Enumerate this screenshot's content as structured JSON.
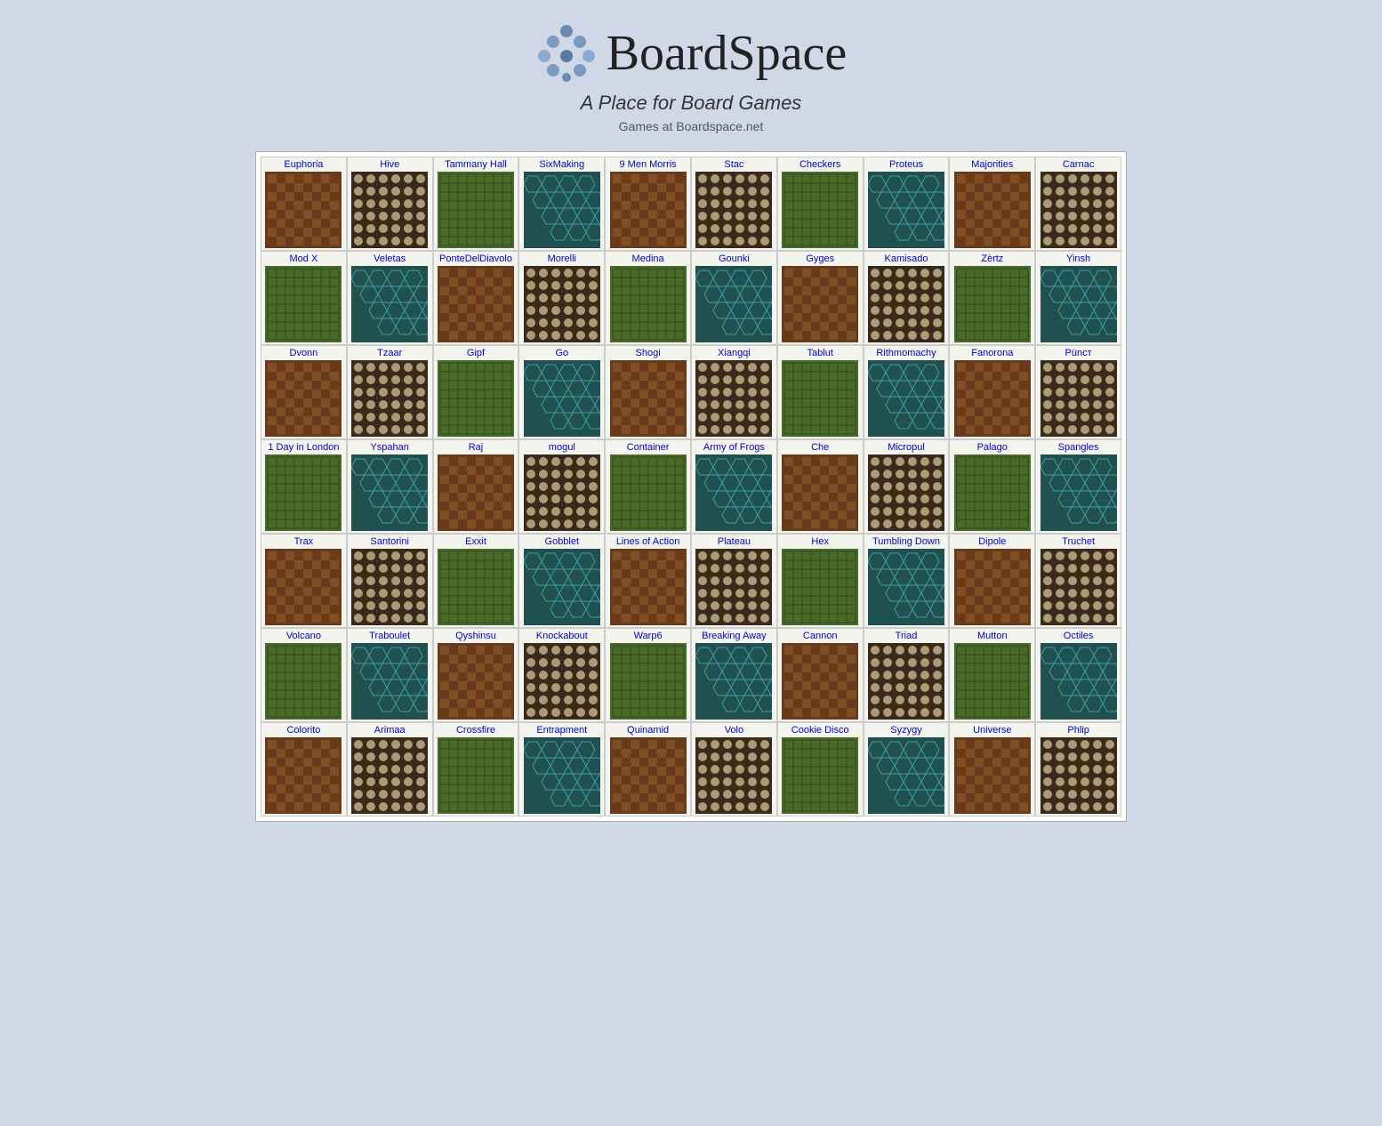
{
  "site": {
    "title": "BoardSpace",
    "tagline": "A Place for Board Games",
    "games_label": "Games at Boardspace.net"
  },
  "games": [
    {
      "name": "Euphoria",
      "color": "c-red"
    },
    {
      "name": "Hive",
      "color": "c-brown"
    },
    {
      "name": "Tammany Hall",
      "color": "c-orange"
    },
    {
      "name": "SixMaking",
      "color": "c-gray"
    },
    {
      "name": "9 Men Morris",
      "color": "c-tan"
    },
    {
      "name": "Stac",
      "color": "c-wood"
    },
    {
      "name": "Checkers",
      "color": "c-dark"
    },
    {
      "name": "Proteus",
      "color": "c-olive"
    },
    {
      "name": "Majorities",
      "color": "c-slate"
    },
    {
      "name": "Carnac",
      "color": "c-navy"
    },
    {
      "name": "Mod X",
      "color": "c-gray"
    },
    {
      "name": "Veletas",
      "color": "c-brown"
    },
    {
      "name": "PonteDelDiavolo",
      "color": "c-blue"
    },
    {
      "name": "Morelli",
      "color": "c-green"
    },
    {
      "name": "Medina",
      "color": "c-tan"
    },
    {
      "name": "Gounki",
      "color": "c-dark"
    },
    {
      "name": "Gyges",
      "color": "c-wood"
    },
    {
      "name": "Kamisado",
      "color": "c-purple"
    },
    {
      "name": "Zèrtz",
      "color": "c-dark"
    },
    {
      "name": "Yinsh",
      "color": "c-cream"
    },
    {
      "name": "Dvonn",
      "color": "c-slate"
    },
    {
      "name": "Tzaar",
      "color": "c-dark"
    },
    {
      "name": "Gipf",
      "color": "c-gray"
    },
    {
      "name": "Go",
      "color": "c-green"
    },
    {
      "name": "Shogi",
      "color": "c-tan"
    },
    {
      "name": "Xiangqi",
      "color": "c-wood"
    },
    {
      "name": "Tablut",
      "color": "c-cream"
    },
    {
      "name": "Rithmomachy",
      "color": "c-brown"
    },
    {
      "name": "Fanorona",
      "color": "c-wood"
    },
    {
      "name": "Püncт",
      "color": "c-gray"
    },
    {
      "name": "1 Day in London",
      "color": "c-blue"
    },
    {
      "name": "Yspahan",
      "color": "c-yellow"
    },
    {
      "name": "Raj",
      "color": "c-red"
    },
    {
      "name": "mogul",
      "color": "c-green"
    },
    {
      "name": "Container",
      "color": "c-teal"
    },
    {
      "name": "Army of Frogs",
      "color": "c-green"
    },
    {
      "name": "Che",
      "color": "c-blue"
    },
    {
      "name": "Micropul",
      "color": "c-orange"
    },
    {
      "name": "Palago",
      "color": "c-olive"
    },
    {
      "name": "Spangles",
      "color": "c-green"
    },
    {
      "name": "Trax",
      "color": "c-green"
    },
    {
      "name": "Santorini",
      "color": "c-gray"
    },
    {
      "name": "Exxit",
      "color": "c-red"
    },
    {
      "name": "Gobblet",
      "color": "c-wood"
    },
    {
      "name": "Lines of Action",
      "color": "c-dark"
    },
    {
      "name": "Plateau",
      "color": "c-tan"
    },
    {
      "name": "Hex",
      "color": "c-pink"
    },
    {
      "name": "Tumbling Down",
      "color": "c-brown"
    },
    {
      "name": "Dipole",
      "color": "c-wood"
    },
    {
      "name": "Truchet",
      "color": "c-blue"
    },
    {
      "name": "Volcano",
      "color": "c-olive"
    },
    {
      "name": "Traboulet",
      "color": "c-gray"
    },
    {
      "name": "Qyshinsu",
      "color": "c-dark"
    },
    {
      "name": "Knockabout",
      "color": "c-teal"
    },
    {
      "name": "Warp6",
      "color": "c-navy"
    },
    {
      "name": "Breaking Away",
      "color": "c-lime"
    },
    {
      "name": "Cannon",
      "color": "c-blue"
    },
    {
      "name": "Triad",
      "color": "c-cream"
    },
    {
      "name": "Mutton",
      "color": "c-green"
    },
    {
      "name": "Octiles",
      "color": "c-sand"
    },
    {
      "name": "Colorito",
      "color": "c-purple"
    },
    {
      "name": "Arimaa",
      "color": "c-tan"
    },
    {
      "name": "Crossfire",
      "color": "c-brown"
    },
    {
      "name": "Entrapment",
      "color": "c-cream"
    },
    {
      "name": "Quinamid",
      "color": "c-maroon"
    },
    {
      "name": "Volo",
      "color": "c-teal"
    },
    {
      "name": "Cookie Disco",
      "color": "c-dark"
    },
    {
      "name": "Syzygy",
      "color": "c-navy"
    },
    {
      "name": "Universe",
      "color": "c-red"
    },
    {
      "name": "Phlip",
      "color": "c-yellow"
    }
  ]
}
